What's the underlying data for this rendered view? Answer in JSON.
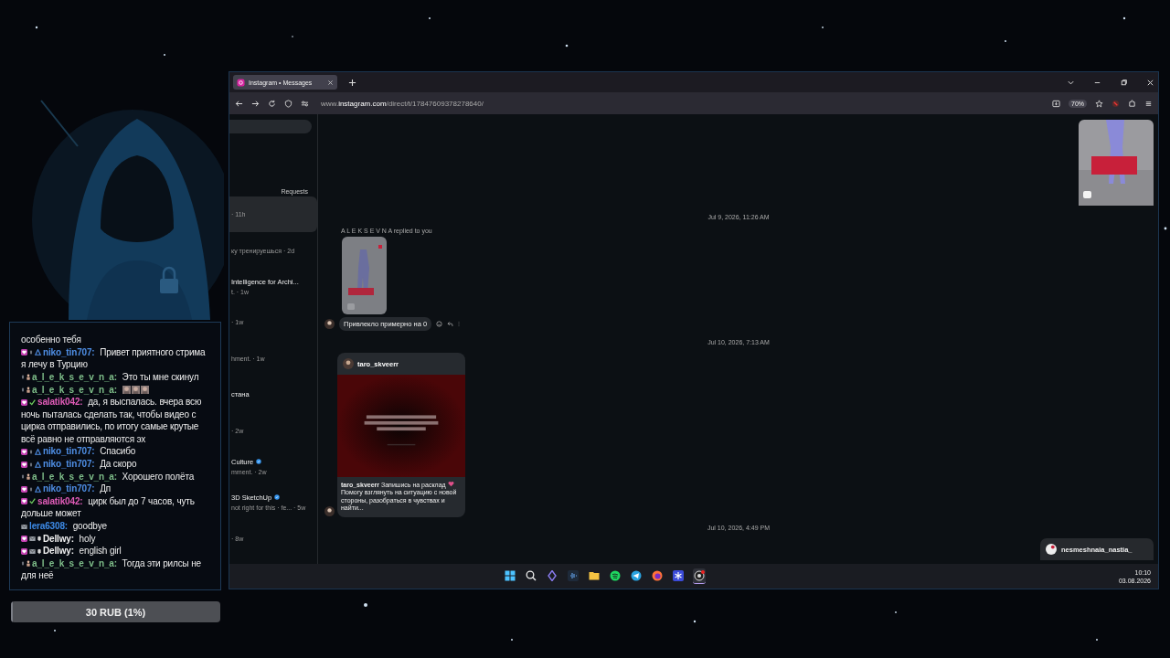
{
  "stream": {
    "chat": {
      "messages": [
        {
          "kind": "continuation",
          "lines": [
            "особенно тебя"
          ]
        },
        {
          "kind": "message",
          "badges": [
            {
              "kind": "sub"
            },
            {
              "kind": "dot"
            },
            {
              "kind": "arrow"
            }
          ],
          "user": "niko_tin707:",
          "color": "#4f8fe6",
          "lines": [
            "Привет приятного стрима",
            "я лечу в Турцию"
          ]
        },
        {
          "kind": "message",
          "badges": [
            {
              "kind": "dot"
            },
            {
              "kind": "cup"
            }
          ],
          "user": "a_l_e_k_s_e_v_n_a:",
          "color": "#7fbf8a",
          "lines": [
            "Это ты мне скинул"
          ]
        },
        {
          "kind": "message",
          "badges": [
            {
              "kind": "dot"
            },
            {
              "kind": "cup"
            }
          ],
          "user": "a_l_e_k_s_e_v_n_a:",
          "color": "#7fbf8a",
          "emotes": [
            {
              "kind": "emote"
            },
            {
              "kind": "emote"
            },
            {
              "kind": "emote"
            }
          ]
        },
        {
          "kind": "message",
          "badges": [
            {
              "kind": "sub"
            },
            {
              "kind": "check"
            }
          ],
          "user": "salatik042:",
          "color": "#e05cb8",
          "lines": [
            "да, я выспалась. вчера всю",
            "ночь пыталась сделать так, чтобы видео с",
            "цирка отправились, по итогу самые крутые",
            "всё равно не отправляются эх"
          ]
        },
        {
          "kind": "message",
          "badges": [
            {
              "kind": "sub"
            },
            {
              "kind": "dot"
            },
            {
              "kind": "arrow"
            }
          ],
          "user": "niko_tin707:",
          "color": "#4f8fe6",
          "lines": [
            "Спасибо"
          ]
        },
        {
          "kind": "message",
          "badges": [
            {
              "kind": "sub"
            },
            {
              "kind": "dot"
            },
            {
              "kind": "arrow"
            }
          ],
          "user": "niko_tin707:",
          "color": "#4f8fe6",
          "lines": [
            "Да скоро"
          ]
        },
        {
          "kind": "message",
          "badges": [
            {
              "kind": "dot"
            },
            {
              "kind": "cup"
            }
          ],
          "user": "a_l_e_k_s_e_v_n_a:",
          "color": "#7fbf8a",
          "lines": [
            "Хорошего полёта"
          ]
        },
        {
          "kind": "message",
          "badges": [
            {
              "kind": "sub"
            },
            {
              "kind": "dot"
            },
            {
              "kind": "arrow"
            }
          ],
          "user": "niko_tin707:",
          "color": "#4f8fe6",
          "lines": [
            "Дп"
          ]
        },
        {
          "kind": "message",
          "badges": [
            {
              "kind": "sub"
            },
            {
              "kind": "check"
            }
          ],
          "user": "salatik042:",
          "color": "#e05cb8",
          "lines": [
            "цирк был до 7 часов, чуть",
            "дольше может"
          ]
        },
        {
          "kind": "message",
          "badges": [
            {
              "kind": "mail"
            }
          ],
          "user": "lera6308:",
          "color": "#3d8be8",
          "lines": [
            "goodbye"
          ]
        },
        {
          "kind": "message",
          "badges": [
            {
              "kind": "sub"
            },
            {
              "kind": "mail"
            },
            {
              "kind": "shield"
            }
          ],
          "user": "Dellwy:",
          "color": "#f2f2f2",
          "lines": [
            "holy"
          ]
        },
        {
          "kind": "message",
          "badges": [
            {
              "kind": "sub"
            },
            {
              "kind": "mail"
            },
            {
              "kind": "shield"
            }
          ],
          "user": "Dellwy:",
          "color": "#f2f2f2",
          "lines": [
            "english girl"
          ]
        },
        {
          "kind": "message",
          "badges": [
            {
              "kind": "dot"
            },
            {
              "kind": "cup"
            }
          ],
          "user": "a_l_e_k_s_e_v_n_a:",
          "color": "#7fbf8a",
          "lines": [
            "Тогда эти рилсы не",
            "для неё"
          ]
        }
      ]
    },
    "donation_goal": {
      "label": "30 RUB (1%)",
      "level": 0.01
    }
  },
  "browser": {
    "tabs": [
      {
        "title": "Instagram • Messages",
        "selected": true
      }
    ],
    "url": "www.**instagram.com**/direct/t/17847609378278640/",
    "zoom": "70%"
  },
  "instagram": {
    "sidebar": {
      "requests": "Requests",
      "conversations": [
        {
          "preview": "· 11h",
          "selected": true
        },
        {
          "preview": "ку тренируешься · 2d",
          "selected": false
        },
        {
          "name": "Intelligence for Archi...",
          "preview": "t. · 1w",
          "selected": false
        },
        {
          "preview": "· 1w",
          "selected": false
        },
        {
          "preview": "hment. · 1w",
          "selected": false
        },
        {
          "name": "стана",
          "selected": false
        },
        {
          "preview": "· 2w",
          "selected": false
        },
        {
          "name": "Culture",
          "verified": true,
          "preview": "mment. · 2w",
          "selected": false
        },
        {
          "name": "3D SketchUp",
          "verified": true,
          "preview": "not right for this · fe... · 5w",
          "selected": false
        },
        {
          "preview": "· 8w",
          "selected": false
        }
      ]
    },
    "thread": [
      {
        "kind": "own_reel"
      },
      {
        "kind": "timestamp",
        "text": "Jul 9, 2026, 11:26 AM"
      },
      {
        "kind": "reply_reel",
        "label": "A L E K S E V N A replied to you",
        "message": "Привлекло примерно на 0"
      },
      {
        "kind": "timestamp",
        "text": "Jul 10, 2026, 7:13 AM"
      },
      {
        "kind": "post_share",
        "author": "taro_skveerr",
        "caption_first": "**taro_skveerr** Запишись на расклад",
        "caption_rest": "Помогу взглянуть на ситуацию с новой стороны, разобраться в чувствах и найти..."
      },
      {
        "kind": "timestamp",
        "text": "Jul 10, 2026, 4:49 PM"
      }
    ],
    "notification": {
      "username": "nesmeshnaia_nastia_"
    }
  },
  "taskbar": {
    "apps": [
      {
        "kind": "start",
        "active": false
      },
      {
        "kind": "search",
        "active": false
      },
      {
        "kind": "diamond",
        "active": false
      },
      {
        "kind": "waves",
        "active": false
      },
      {
        "kind": "folder",
        "active": false
      },
      {
        "kind": "spotify",
        "active": false
      },
      {
        "kind": "telegram",
        "active": false
      },
      {
        "kind": "firefox",
        "active": false
      },
      {
        "kind": "asterisk",
        "active": false
      },
      {
        "kind": "obs",
        "active": true
      }
    ],
    "time": "10:10",
    "date": "03.08.2026"
  }
}
